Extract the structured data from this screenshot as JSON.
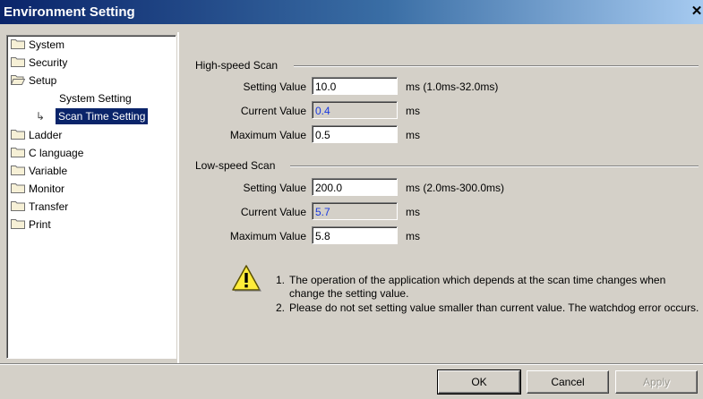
{
  "window": {
    "title": "Environment Setting",
    "close_glyph": "✕"
  },
  "tree": {
    "items": [
      {
        "label": "System"
      },
      {
        "label": "Security"
      },
      {
        "label": "Setup"
      },
      {
        "label": "System Setting"
      },
      {
        "label": "Scan Time Setting",
        "selected": true
      },
      {
        "label": "Ladder"
      },
      {
        "label": "C language"
      },
      {
        "label": "Variable"
      },
      {
        "label": "Monitor"
      },
      {
        "label": "Transfer"
      },
      {
        "label": "Print"
      }
    ]
  },
  "high_speed": {
    "title": "High-speed Scan",
    "setting_label": "Setting Value",
    "setting_value": "10.0",
    "setting_unit": "ms (1.0ms-32.0ms)",
    "current_label": "Current Value",
    "current_value": "0.4",
    "current_unit": "ms",
    "max_label": "Maximum Value",
    "max_value": "0.5",
    "max_unit": "ms"
  },
  "low_speed": {
    "title": "Low-speed Scan",
    "setting_label": "Setting Value",
    "setting_value": "200.0",
    "setting_unit": "ms (2.0ms-300.0ms)",
    "current_label": "Current Value",
    "current_value": "5.7",
    "current_unit": "ms",
    "max_label": "Maximum Value",
    "max_value": "5.8",
    "max_unit": "ms"
  },
  "notes": {
    "icon": "warning-icon",
    "items": [
      {
        "num": "1.",
        "text": "The operation of the application which depends at the scan time changes when change the setting value."
      },
      {
        "num": "2.",
        "text": "Please do not set setting value smaller than current value.  The watchdog error occurs."
      }
    ]
  },
  "buttons": {
    "ok": "OK",
    "cancel": "Cancel",
    "apply": "Apply"
  },
  "colors": {
    "title_start": "#0a246a",
    "title_end": "#a6caf0",
    "readonly_text": "#1a3adf",
    "face": "#d4d0c8"
  }
}
